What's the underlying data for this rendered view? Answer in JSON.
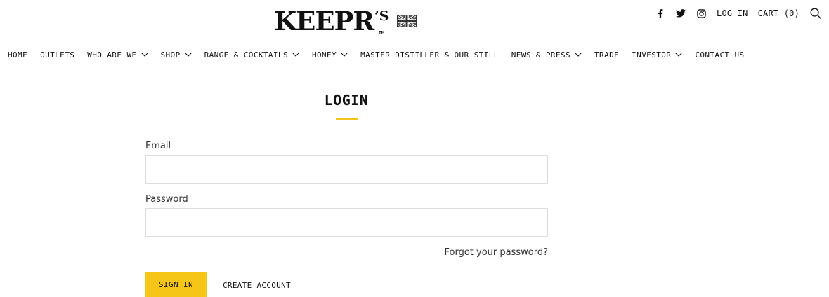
{
  "brand": {
    "logo_text": "KEEPR",
    "logo_sup": "’S",
    "logo_tm": "TM",
    "flag_icon": "union-jack-flag-icon"
  },
  "utility": {
    "social_icons": [
      "facebook-icon",
      "twitter-icon",
      "instagram-icon"
    ],
    "login_label": "LOG IN",
    "cart_label": "CART (0)",
    "search_icon": "search-icon"
  },
  "nav": {
    "items": [
      {
        "label": "HOME",
        "dropdown": false
      },
      {
        "label": "OUTLETS",
        "dropdown": false
      },
      {
        "label": "WHO ARE WE",
        "dropdown": true
      },
      {
        "label": "SHOP",
        "dropdown": true
      },
      {
        "label": "RANGE & COCKTAILS",
        "dropdown": true
      },
      {
        "label": "HONEY",
        "dropdown": true
      },
      {
        "label": "MASTER DISTILLER & OUR STILL",
        "dropdown": false
      },
      {
        "label": "NEWS & PRESS",
        "dropdown": true
      },
      {
        "label": "TRADE",
        "dropdown": false
      },
      {
        "label": "INVESTOR",
        "dropdown": true
      },
      {
        "label": "CONTACT US",
        "dropdown": false
      }
    ]
  },
  "login": {
    "title": "LOGIN",
    "email_label": "Email",
    "email_value": "",
    "password_label": "Password",
    "password_value": "",
    "forgot_label": "Forgot your password?",
    "signin_label": "SIGN IN",
    "create_label": "CREATE ACCOUNT"
  },
  "colors": {
    "accent": "#f5c518",
    "title_bar": "#f0c419",
    "input_border": "#dcdcdc",
    "text": "#111111"
  }
}
